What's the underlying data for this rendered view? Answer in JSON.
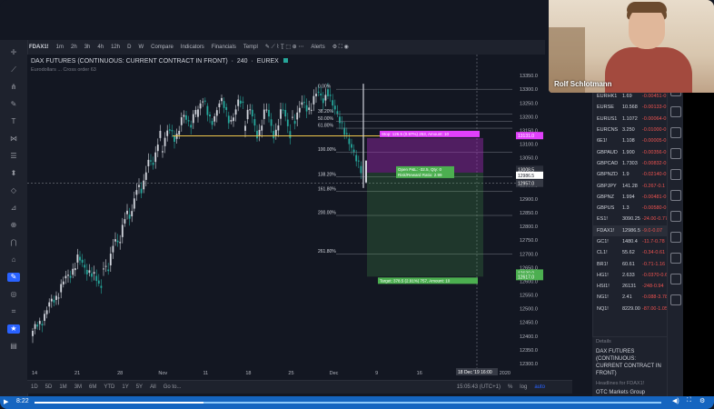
{
  "toolbar": {
    "symbol": "FDAX1!",
    "intervals": [
      "1m",
      "2h",
      "3h",
      "4h",
      "12h",
      "D",
      "W"
    ],
    "compare": "Compare",
    "indicators": "Indicators",
    "financials": "Financials",
    "templates": "Templ",
    "alerts": "Alerts"
  },
  "chart": {
    "title": "DAX FUTURES (CONTINUOUS: CURRENT CONTRACT IN FRONT)",
    "interval": "240",
    "exchange": "EUREX",
    "subtitle": "Eurodollars ... Cross order 63",
    "cursor_date": "18 Dec '19",
    "cursor_time": "16:00"
  },
  "chart_data": {
    "type": "candlestick",
    "ylim": [
      12300,
      13400
    ],
    "y_ticks": [
      "13350.0",
      "13300.0",
      "13250.0",
      "13200.0",
      "13150.0",
      "13100.0",
      "13050.0",
      "13000.0",
      "12950.0",
      "12900.0",
      "12850.0",
      "12800.0",
      "12750.0",
      "12700.0",
      "12650.0",
      "12600.0",
      "12550.0",
      "12500.0",
      "12450.0",
      "12400.0",
      "12350.0",
      "12300.0"
    ],
    "x_ticks": [
      "14",
      "21",
      "28",
      "Nov",
      "11",
      "18",
      "25",
      "Dec",
      "9",
      "16",
      "23",
      "2020"
    ],
    "price_labels": {
      "current": "12986.5",
      "cursor": "12957.0",
      "upper": "13131.0",
      "upper2": "13008.5",
      "lower1": "12630.0",
      "lower2": "12617.0"
    },
    "fib_levels": [
      {
        "label": "0.00%",
        "value": 13300
      },
      {
        "label": "38.20%",
        "value": 13210
      },
      {
        "label": "50.00%",
        "value": 13183
      },
      {
        "label": "61.80%",
        "value": 13158
      },
      {
        "label": "100.00%",
        "value": 13070
      },
      {
        "label": "138.20%",
        "value": 12980
      },
      {
        "label": "161.80%",
        "value": 12927
      },
      {
        "label": "200.00%",
        "value": 12840
      },
      {
        "label": "261.80%",
        "value": 12700
      }
    ],
    "position": {
      "stop_label": "Stop: 126.5 (0.97%) 253, Amount: 10",
      "open_label": "Open P&L: -32.5, Qty: 0",
      "ratio_label": "Risk/Reward Ratio: 2.99",
      "target_label": "Target: 378.5 (2.91%) 757, Amount: 10",
      "entry": 12996,
      "stop": 13122,
      "target": 12617
    },
    "horizontal_line": 13130
  },
  "watchlist": [
    {
      "sym": "EURHK1",
      "last": "1.69",
      "chg": "-0.00451",
      "pct": "-0."
    },
    {
      "sym": "EURSE",
      "last": "10.568",
      "chg": "-0.00133",
      "pct": "-0."
    },
    {
      "sym": "EURUS1",
      "last": "1.1072",
      "chg": "-0.00064",
      "pct": "-0."
    },
    {
      "sym": "EURCNS",
      "last": "3.250",
      "chg": "-0.01000",
      "pct": "-0."
    },
    {
      "sym": "6E1!",
      "last": "1.108",
      "chg": "-0.00005",
      "pct": "-0."
    },
    {
      "sym": "GBPAUD",
      "last": "1.900",
      "chg": "-0.00356",
      "pct": "-0."
    },
    {
      "sym": "GBPCAD",
      "last": "1.7303",
      "chg": "-0.00832",
      "pct": "-0."
    },
    {
      "sym": "GBPNZD",
      "last": "1.9",
      "chg": "-0.02140",
      "pct": "-0."
    },
    {
      "sym": "GBPJPY",
      "last": "141.28",
      "chg": "-0.267",
      "pct": "-0.1"
    },
    {
      "sym": "GBPNZ",
      "last": "1.994",
      "chg": "-0.00481",
      "pct": "-0."
    },
    {
      "sym": "GBPUS",
      "last": "1.3",
      "chg": "-0.00580",
      "pct": "-0."
    },
    {
      "sym": "ES1!",
      "last": "3090.25",
      "chg": "-24.00",
      "pct": "-0.77"
    },
    {
      "sym": "FDAX1!",
      "last": "12986.5",
      "chg": "-9.0",
      "pct": "-0.07"
    },
    {
      "sym": "GC1!",
      "last": "1480.4",
      "chg": "-11.7",
      "pct": "-0.78"
    },
    {
      "sym": "CL1!",
      "last": "55.62",
      "chg": "-0.34",
      "pct": "-0.61"
    },
    {
      "sym": "BR1!",
      "last": "60.61",
      "chg": "-0.71",
      "pct": "-1.16"
    },
    {
      "sym": "HG1!",
      "last": "2.633",
      "chg": "-0.0370",
      "pct": "-0.6"
    },
    {
      "sym": "HSI1!",
      "last": "26131",
      "chg": "-248",
      "pct": "-0.94"
    },
    {
      "sym": "NG1!",
      "last": "2.41",
      "chg": "-0.088",
      "pct": "-3.78"
    },
    {
      "sym": "NQ1!",
      "last": "8229.00",
      "chg": "-87.00",
      "pct": "-1.05"
    }
  ],
  "details": {
    "label": "Details",
    "name": "DAX FUTURES (CONTINUOUS: CURRENT CONTRACT IN FRONT)",
    "headlines": "Headlines for FDAX1!",
    "otc": "OTC Markets Group"
  },
  "bottom": {
    "ranges": [
      "1D",
      "5D",
      "1M",
      "3M",
      "6M",
      "YTD",
      "1Y",
      "5Y",
      "All"
    ],
    "goto": "Go to...",
    "clock": "15:05:43 (UTC+1)",
    "pct": "%",
    "log": "log",
    "auto": "auto"
  },
  "webcam": {
    "name": "Rolf Schlotmann"
  },
  "video": {
    "time": "8:22",
    "progress": 0.27
  }
}
